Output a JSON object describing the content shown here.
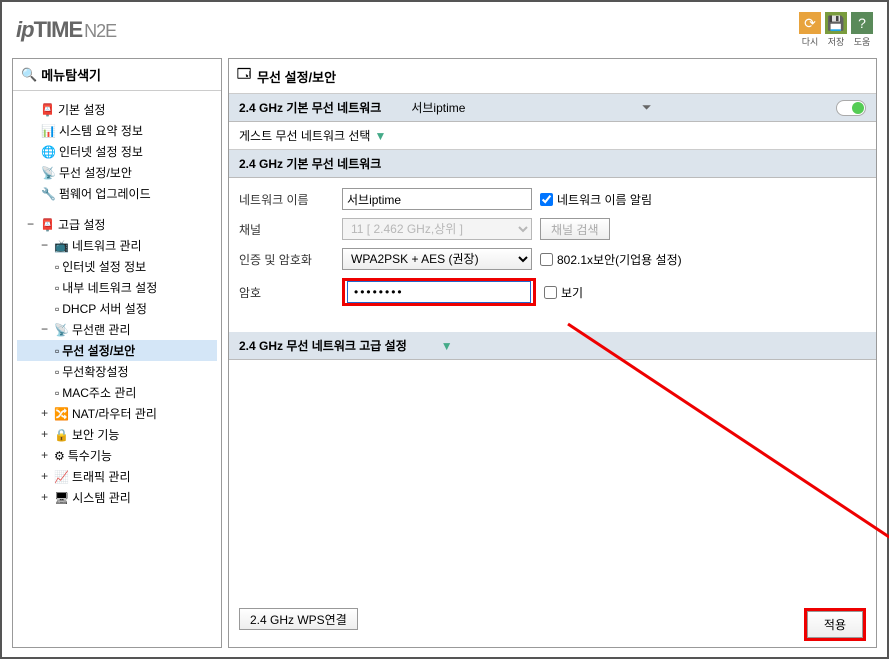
{
  "logo": {
    "prefix": "ip",
    "brand": "TIME",
    "model": "N2E"
  },
  "headerIcons": [
    {
      "label": "다시",
      "color": "#e8a33d"
    },
    {
      "label": "저장",
      "color": "#7a9c3e"
    },
    {
      "label": "도움",
      "color": "#5a8a5a"
    }
  ],
  "sidebar": {
    "title": "메뉴탐색기",
    "basic": {
      "label": "기본 설정",
      "items": [
        "시스템 요약 정보",
        "인터넷 설정 정보",
        "무선 설정/보안",
        "펌웨어 업그레이드"
      ]
    },
    "advanced": {
      "label": "고급 설정",
      "network": {
        "label": "네트워크 관리",
        "items": [
          "인터넷 설정 정보",
          "내부 네트워크 설정",
          "DHCP 서버 설정"
        ]
      },
      "wireless": {
        "label": "무선랜 관리",
        "items": [
          "무선 설정/보안",
          "무선확장설정",
          "MAC주소 관리"
        ]
      },
      "rest": [
        "NAT/라우터 관리",
        "보안 기능",
        "특수기능",
        "트래픽 관리",
        "시스템 관리"
      ]
    }
  },
  "main": {
    "title": "무선 설정/보안",
    "networkBand": "2.4 GHz 기본 무선 네트워크",
    "ssid": "서브iptime",
    "toggle": "on",
    "guestLabel": "게스트 무선 네트워크 선택",
    "sectionTitle": "2.4 GHz 기본 무선 네트워크",
    "fields": {
      "networkName": {
        "label": "네트워크 이름",
        "value": "서브iptime",
        "broadcast": "네트워크 이름 알림"
      },
      "channel": {
        "label": "채널",
        "value": "11 [ 2.462 GHz,상위 ]",
        "search": "채널 검색"
      },
      "auth": {
        "label": "인증 및 암호화",
        "value": "WPA2PSK + AES (권장)",
        "enterprise": "802.1x보안(기업용 설정)"
      },
      "password": {
        "label": "암호",
        "value": "••••••••",
        "show": "보기"
      }
    },
    "advancedSection": "2.4 GHz 무선 네트워크 고급 설정",
    "wpsButton": "2.4 GHz WPS연결",
    "applyButton": "적용"
  }
}
